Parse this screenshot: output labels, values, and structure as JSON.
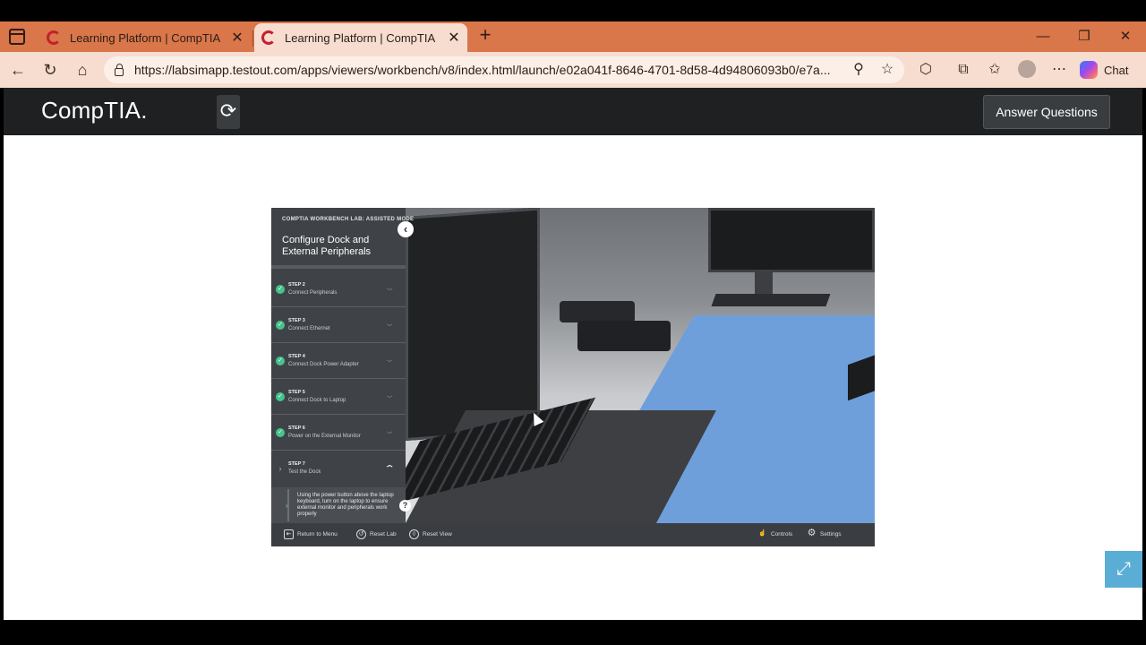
{
  "browser": {
    "tabs": [
      {
        "title": "Learning Platform | CompTIA",
        "close": "✕"
      },
      {
        "title": "Learning Platform | CompTIA",
        "close": "✕"
      }
    ],
    "new_tab": "+",
    "window_controls": {
      "minimize": "—",
      "restore": "❐",
      "close": "✕"
    },
    "url": "https://labsimapp.testout.com/apps/viewers/workbench/v8/index.html/launch/e02a041f-8646-4701-8d58-4d94806093b0/e7a...",
    "chat_label": "Chat",
    "icons": {
      "back": "←",
      "refresh": "↻",
      "home": "⌂",
      "zoom": "⚲",
      "favorite": "☆",
      "extensions": "⬡",
      "collections": "⧉",
      "favorites": "✩",
      "more": "⋯"
    }
  },
  "header": {
    "logo": "CompTIA.",
    "refresh_icon": "⟳",
    "answer_button": "Answer Questions"
  },
  "lab": {
    "mode": "COMPTIA WORKBENCH LAB: ASSISTED MODE",
    "title": "Configure Dock and External Peripherals",
    "collapse_icon": "‹",
    "steps": [
      {
        "number": "STEP 2",
        "name": "Connect Peripherals",
        "status": "complete"
      },
      {
        "number": "STEP 3",
        "name": "Connect Ethernet",
        "status": "complete"
      },
      {
        "number": "STEP 4",
        "name": "Connect Dock Power Adapter",
        "status": "complete"
      },
      {
        "number": "STEP 5",
        "name": "Connect Dock to Laptop",
        "status": "complete"
      },
      {
        "number": "STEP 6",
        "name": "Power on the External Monitor",
        "status": "complete"
      },
      {
        "number": "STEP 7",
        "name": "Test the Dock",
        "status": "current"
      }
    ],
    "current_instruction": "Using the power button above the laptop keyboard, turn on the laptop to ensure external monitor and peripherals work properly",
    "help_icon": "?",
    "footer": {
      "return_menu": "Return to Menu",
      "reset_lab": "Reset Lab",
      "reset_view": "Reset View",
      "controls": "Controls",
      "settings": "Settings"
    }
  },
  "fullscreen_icon": "⤢",
  "colors": {
    "tab_bar": "#d9764a",
    "header": "#1e2022",
    "complete": "#45c48c",
    "fullscreen": "#5aaed6"
  }
}
